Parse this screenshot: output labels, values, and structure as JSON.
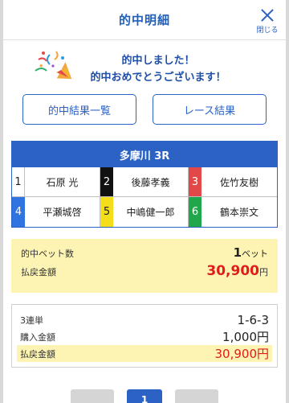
{
  "header": {
    "title": "的中明細",
    "close_label": "閉じる"
  },
  "congrats": {
    "line1": "的中しました！",
    "line2": "的中おめでとうございます！"
  },
  "buttons": {
    "hit_results": "的中結果一覧",
    "race_results": "レース結果"
  },
  "race": {
    "title": "多摩川 3R",
    "racers": [
      {
        "num": "1",
        "name": "石原 光",
        "bg": "#ffffff",
        "fg": "#222222"
      },
      {
        "num": "2",
        "name": "後藤孝義",
        "bg": "#111111",
        "fg": "#ffffff"
      },
      {
        "num": "3",
        "name": "佐竹友樹",
        "bg": "#e34848",
        "fg": "#ffffff"
      },
      {
        "num": "4",
        "name": "平瀬城啓",
        "bg": "#2f74e0",
        "fg": "#ffffff"
      },
      {
        "num": "5",
        "name": "中嶋健一郎",
        "bg": "#f4de1c",
        "fg": "#222222"
      },
      {
        "num": "6",
        "name": "鶴本崇文",
        "bg": "#20a74c",
        "fg": "#ffffff"
      }
    ]
  },
  "summary": {
    "bets_label": "的中ベット数",
    "bets_value": "1",
    "bets_unit": "ベット",
    "payout_label": "払戻金額",
    "payout_value": "30,900",
    "payout_unit": "円"
  },
  "detail": {
    "bet_type_label": "3連単",
    "combination": "1-6-3",
    "purchase_label": "購入金額",
    "purchase_value": "1,000円",
    "payout_label": "払戻金額",
    "payout_value": "30,900円"
  },
  "pager": {
    "current": "1"
  },
  "colors": {
    "accent": "#2b62c4",
    "highlight": "#fdf4b3",
    "payout": "#e21b1b"
  }
}
